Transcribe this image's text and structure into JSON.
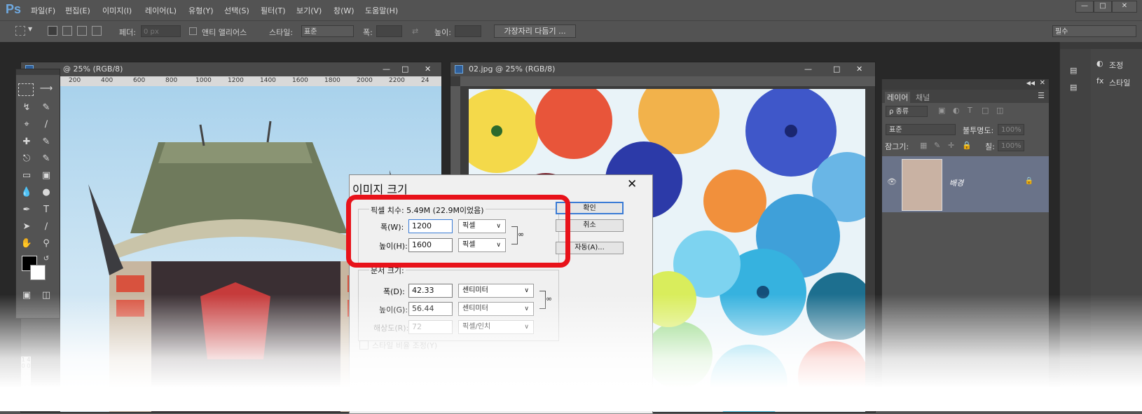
{
  "app": {
    "logo": "Ps"
  },
  "menu": {
    "items": [
      "파일(F)",
      "편집(E)",
      "이미지(I)",
      "레이어(L)",
      "유형(Y)",
      "선택(S)",
      "필터(T)",
      "보기(V)",
      "창(W)",
      "도움말(H)"
    ]
  },
  "options_bar": {
    "feather_label": "페더:",
    "feather_value": "0 px",
    "antialias_label": "앤티 앨리어스",
    "style_label": "스타일:",
    "style_value": "표준",
    "width_label": "폭:",
    "height_label": "높이:",
    "refine_button": "가장자리 다듬기 ...",
    "workspace_value": "필수"
  },
  "doc1": {
    "title": "@ 25% (RGB/8)",
    "ruler": [
      "200",
      "400",
      "600",
      "800",
      "1000",
      "1200",
      "1400",
      "1600",
      "1800",
      "2000",
      "2200",
      "24"
    ],
    "vruler": "1 4 0 0"
  },
  "doc2": {
    "title": "02.jpg @ 25% (RGB/8)"
  },
  "layers_panel": {
    "tabs": [
      "레이어",
      "채널"
    ],
    "filter_value": "ρ 종류",
    "blend_mode": "표준",
    "opacity_label": "불투명도:",
    "opacity_value": "100%",
    "lock_label": "잠그기:",
    "fill_label": "칠:",
    "fill_value": "100%",
    "layer_name": "배경"
  },
  "right_dock": {
    "items": [
      "조정",
      "스타일"
    ]
  },
  "dialog": {
    "title": "이미지 크기",
    "pixel_dimensions": "픽셀 치수: 5.49M (22.9M이었음)",
    "width_label": "폭(W):",
    "width_value": "1200",
    "width_unit": "픽셀",
    "height_label": "높이(H):",
    "height_value": "1600",
    "height_unit": "픽셀",
    "doc_size_label": "문서 크기:",
    "doc_width_label": "폭(D):",
    "doc_width_value": "42.33",
    "doc_width_unit": "센티미터",
    "doc_height_label": "높이(G):",
    "doc_height_value": "56.44",
    "doc_height_unit": "센티미터",
    "resolution_label": "해상도(R):",
    "resolution_value": "72",
    "resolution_unit": "픽셀/인치",
    "scale_styles": "스타일 비율 조정(Y)",
    "ok_button": "확인",
    "cancel_button": "취소",
    "auto_button": "자동(A)..."
  },
  "colors": {
    "highlight": "#e8121a",
    "ps_blue": "#6fa9e0"
  }
}
